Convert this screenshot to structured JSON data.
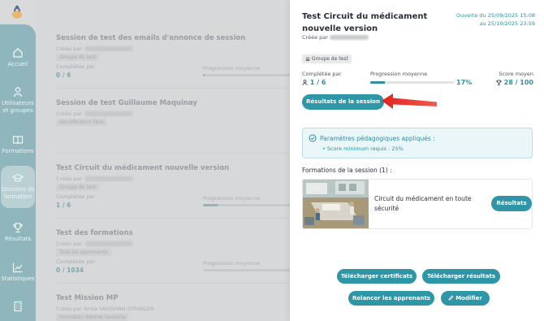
{
  "sidebar": {
    "items": [
      {
        "label": "Accueil",
        "icon": "home-icon"
      },
      {
        "label": "Utilisateurs et groupes",
        "icon": "user-icon"
      },
      {
        "label": "Formations",
        "icon": "book-icon"
      },
      {
        "label": "Sessions de formation",
        "icon": "graduation-cap-icon"
      },
      {
        "label": "Résultats",
        "icon": "trophy-icon"
      },
      {
        "label": "Statistiques",
        "icon": "chart-icon"
      },
      {
        "label": "",
        "icon": "building-icon"
      }
    ]
  },
  "list": {
    "sessions": [
      {
        "title": "Session de test des emails d'annonce de session",
        "creator_prefix": "Créée par",
        "tag": "Groupe de test",
        "completed_label": "Complétée par",
        "completed_value": "0 / 6",
        "progress_label": "Progression moyenne",
        "progress": 0.02
      },
      {
        "title": "Session de test Guillaume Maquinay",
        "creator_prefix": "Créée par",
        "tag": "Identification libre",
        "completed_label": "",
        "completed_value": "",
        "progress_label": "",
        "progress": null
      },
      {
        "title": "Test Circuit du médicament nouvelle version",
        "creator_prefix": "Créée par",
        "tag": "Groupe de test",
        "completed_label": "Complétée par",
        "completed_value": "1 / 6",
        "progress_label": "Progression moyenne",
        "progress": 0.17
      },
      {
        "title": "Test des formations",
        "creator_prefix": "Créée par",
        "tag": "Tous les apprenants",
        "completed_label": "Complétée par",
        "completed_value": "0 / 1034",
        "progress_label": "Progression moyenne",
        "progress": 0.0
      },
      {
        "title": "Test Mission MP",
        "creator_prefix": "Créée par Anita VAUGHAN-STRINGER",
        "tag": "Formation Interne Sensoria",
        "completed_label": "",
        "completed_value": "",
        "progress_label": "",
        "progress": null
      }
    ]
  },
  "panel": {
    "title": "Test Circuit du médicament nouvelle version",
    "creator_prefix": "Créée par",
    "opened": "Ouverte du 25/09/2025 15:08",
    "until": "au 25/10/2025 23:59",
    "tag": "Groupe de test",
    "stats": {
      "completed_label": "Complétée par",
      "completed_value": "1 / 6",
      "progress_label": "Progression moyenne",
      "progress_value": "17%",
      "progress": 0.17,
      "score_label": "Score moyen",
      "score_value": "28 / 100"
    },
    "results_button": "Résultats de la session",
    "params": {
      "title": "Paramètres pédagogiques appliqués :",
      "item": "Score minimum requis : 25%"
    },
    "courses_title": "Formations de la session (1) :",
    "course": {
      "name": "Circuit du médicament en toute sécurité",
      "button": "Résultats"
    },
    "actions": {
      "download_certs": "Télécharger certificats",
      "download_results": "Télécharger résultats",
      "remind": "Relancer les apprenants",
      "edit": "Modifier"
    }
  },
  "colors": {
    "accent": "#2f96a8",
    "sidebar": "#8fb6bc",
    "arrow": "#e0221f"
  }
}
